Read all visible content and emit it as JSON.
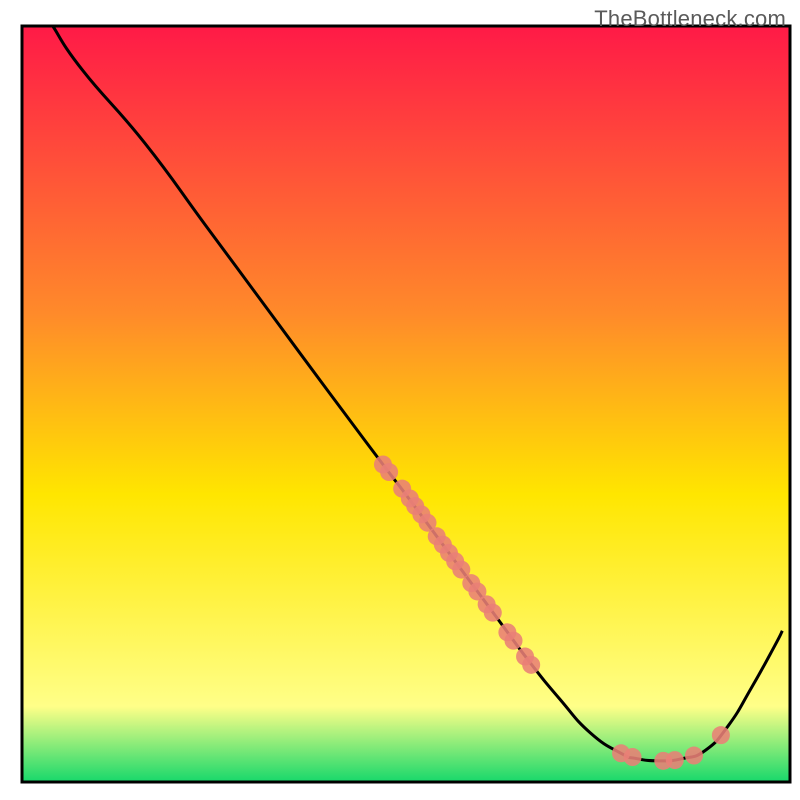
{
  "attribution": "TheBottleneck.com",
  "chart_data": {
    "type": "line",
    "title": "",
    "xlabel": "",
    "ylabel": "",
    "xlim": [
      0,
      100
    ],
    "ylim": [
      0,
      100
    ],
    "grid": false,
    "legend": false,
    "background_gradient_top": "#ff1a47",
    "background_gradient_mid_upper": "#ff8a2a",
    "background_gradient_mid": "#ffe600",
    "background_gradient_low_yellow": "#ffff88",
    "background_gradient_green": "#17d86b",
    "curve": {
      "name": "bottleneck-curve",
      "stroke": "#000000",
      "points": [
        {
          "x": 4.0,
          "y": 100.0
        },
        {
          "x": 8.0,
          "y": 94.0
        },
        {
          "x": 16.0,
          "y": 84.5
        },
        {
          "x": 24.0,
          "y": 73.5
        },
        {
          "x": 32.0,
          "y": 62.5
        },
        {
          "x": 40.0,
          "y": 51.5
        },
        {
          "x": 47.0,
          "y": 42.0
        },
        {
          "x": 50.0,
          "y": 38.0
        },
        {
          "x": 54.0,
          "y": 32.5
        },
        {
          "x": 58.0,
          "y": 27.0
        },
        {
          "x": 62.0,
          "y": 21.5
        },
        {
          "x": 66.0,
          "y": 16.0
        },
        {
          "x": 70.0,
          "y": 11.0
        },
        {
          "x": 74.0,
          "y": 6.5
        },
        {
          "x": 78.0,
          "y": 3.8
        },
        {
          "x": 80.0,
          "y": 3.1
        },
        {
          "x": 83.0,
          "y": 2.8
        },
        {
          "x": 86.0,
          "y": 3.1
        },
        {
          "x": 89.0,
          "y": 4.2
        },
        {
          "x": 92.0,
          "y": 7.5
        },
        {
          "x": 95.0,
          "y": 12.5
        },
        {
          "x": 98.0,
          "y": 18.0
        },
        {
          "x": 99.0,
          "y": 20.0
        }
      ]
    },
    "markers": {
      "name": "highlight-points",
      "fill": "#e98076",
      "points": [
        {
          "x": 47.0,
          "y": 42.0
        },
        {
          "x": 47.8,
          "y": 41.0
        },
        {
          "x": 49.5,
          "y": 38.8
        },
        {
          "x": 50.5,
          "y": 37.5
        },
        {
          "x": 51.2,
          "y": 36.5
        },
        {
          "x": 52.0,
          "y": 35.4
        },
        {
          "x": 52.8,
          "y": 34.3
        },
        {
          "x": 54.0,
          "y": 32.5
        },
        {
          "x": 54.8,
          "y": 31.4
        },
        {
          "x": 55.6,
          "y": 30.3
        },
        {
          "x": 56.4,
          "y": 29.2
        },
        {
          "x": 57.2,
          "y": 28.1
        },
        {
          "x": 58.5,
          "y": 26.3
        },
        {
          "x": 59.3,
          "y": 25.2
        },
        {
          "x": 60.5,
          "y": 23.5
        },
        {
          "x": 61.3,
          "y": 22.4
        },
        {
          "x": 63.2,
          "y": 19.8
        },
        {
          "x": 64.0,
          "y": 18.7
        },
        {
          "x": 65.5,
          "y": 16.6
        },
        {
          "x": 66.3,
          "y": 15.5
        },
        {
          "x": 78.0,
          "y": 3.8
        },
        {
          "x": 79.5,
          "y": 3.3
        },
        {
          "x": 83.5,
          "y": 2.8
        },
        {
          "x": 85.0,
          "y": 2.9
        },
        {
          "x": 87.5,
          "y": 3.5
        },
        {
          "x": 91.0,
          "y": 6.2
        }
      ]
    }
  }
}
